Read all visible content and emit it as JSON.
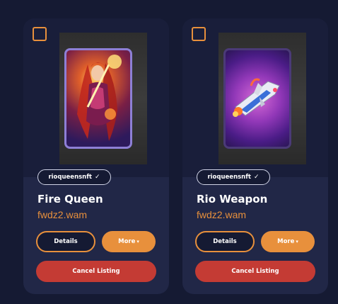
{
  "listings": [
    {
      "owner": "rioqueensnft",
      "title": "Fire Queen",
      "wallet": "fwdz2.wam",
      "details_label": "Details",
      "more_label": "More",
      "cancel_label": "Cancel Listing"
    },
    {
      "owner": "rioqueensnft",
      "title": "Rio Weapon",
      "wallet": "fwdz2.wam",
      "details_label": "Details",
      "more_label": "More",
      "cancel_label": "Cancel Listing"
    }
  ],
  "icons": {
    "verified": "check-icon",
    "more_caret": "chevron-down-icon",
    "select": "checkbox"
  },
  "colors": {
    "accent": "#e8903c",
    "danger": "#c43b34",
    "card": "#212747",
    "background": "#151a33"
  }
}
